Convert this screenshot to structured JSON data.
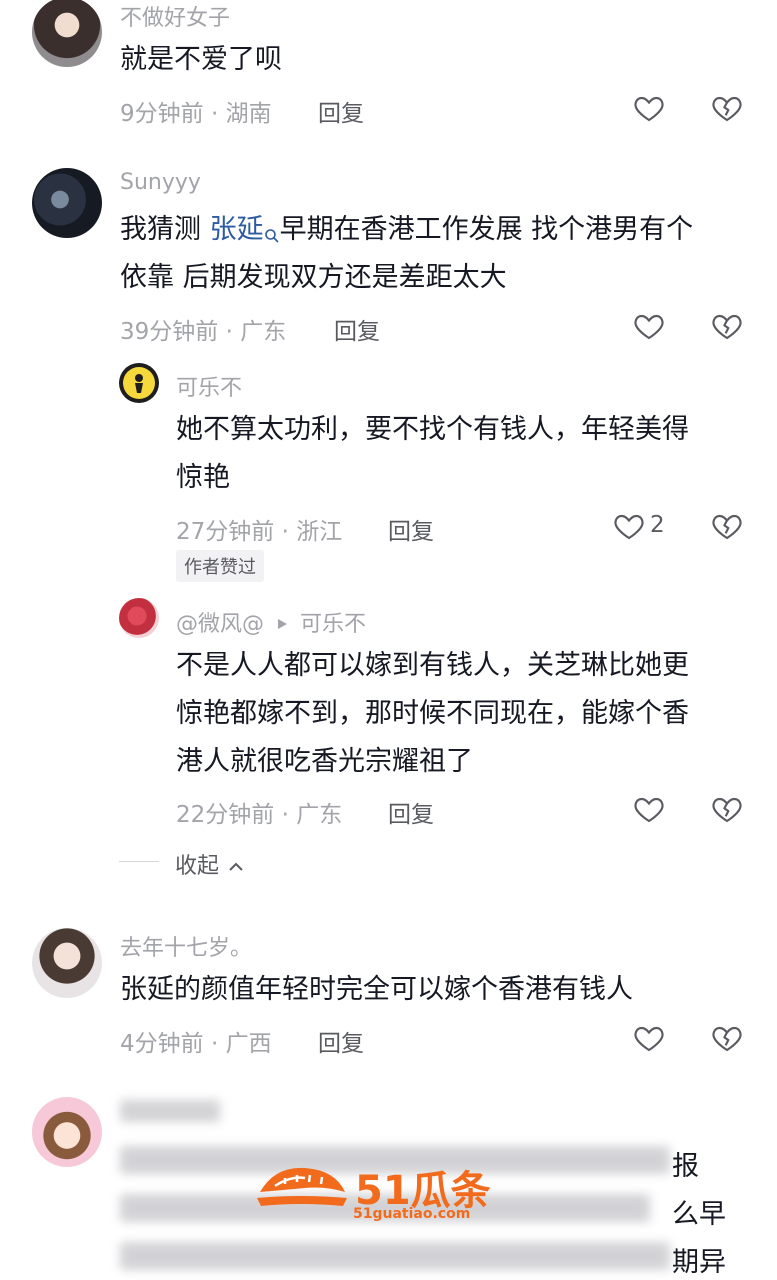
{
  "comments": [
    {
      "username": "不做好女子",
      "text": "就是不爱了呗",
      "meta": "9分钟前 · 湖南",
      "reply_label": "回复"
    },
    {
      "username": "Sunyyy",
      "text_line1_pre": "我猜测 ",
      "mention": "张延",
      "text_line1_post": "早期在香港工作发展 找个港男有个",
      "text_line2": "依靠  后期发现双方还是差距太大",
      "meta": "39分钟前 · 广东",
      "reply_label": "回复",
      "replies": [
        {
          "username": "可乐不",
          "text_line1": "她不算太功利，要不找个有钱人，年轻美得",
          "text_line2": "惊艳",
          "meta": "27分钟前 · 浙江",
          "reply_label": "回复",
          "like_count": "2",
          "badge": "作者赞过"
        },
        {
          "username": "@微风@",
          "reply_to": "可乐不",
          "text_line1": "不是人人都可以嫁到有钱人，关芝琳比她更",
          "text_line2": "惊艳都嫁不到，那时候不同现在，能嫁个香",
          "text_line3": "港人就很吃香光宗耀祖了",
          "meta": "22分钟前 · 广东",
          "reply_label": "回复"
        }
      ],
      "collapse_label": "收起"
    },
    {
      "username": "去年十七岁。",
      "text": "张延的颜值年轻时完全可以嫁个香港有钱人",
      "meta": "4分钟前 · 广西",
      "reply_label": "回复"
    },
    {
      "partial_chars": [
        "报",
        "么早",
        "期异"
      ]
    }
  ],
  "watermark": {
    "brand": "51瓜条",
    "url": "51guatiao.com"
  },
  "icons": {
    "like": "heart-outline-icon",
    "dislike": "broken-heart-icon",
    "search": "search-icon",
    "play": "play-triangle-icon",
    "chevron": "chevron-up-icon"
  },
  "colors": {
    "text": "#161823",
    "meta": "#a3a4a9",
    "mention": "#2d5aa0",
    "watermark": "#f26b1d"
  }
}
